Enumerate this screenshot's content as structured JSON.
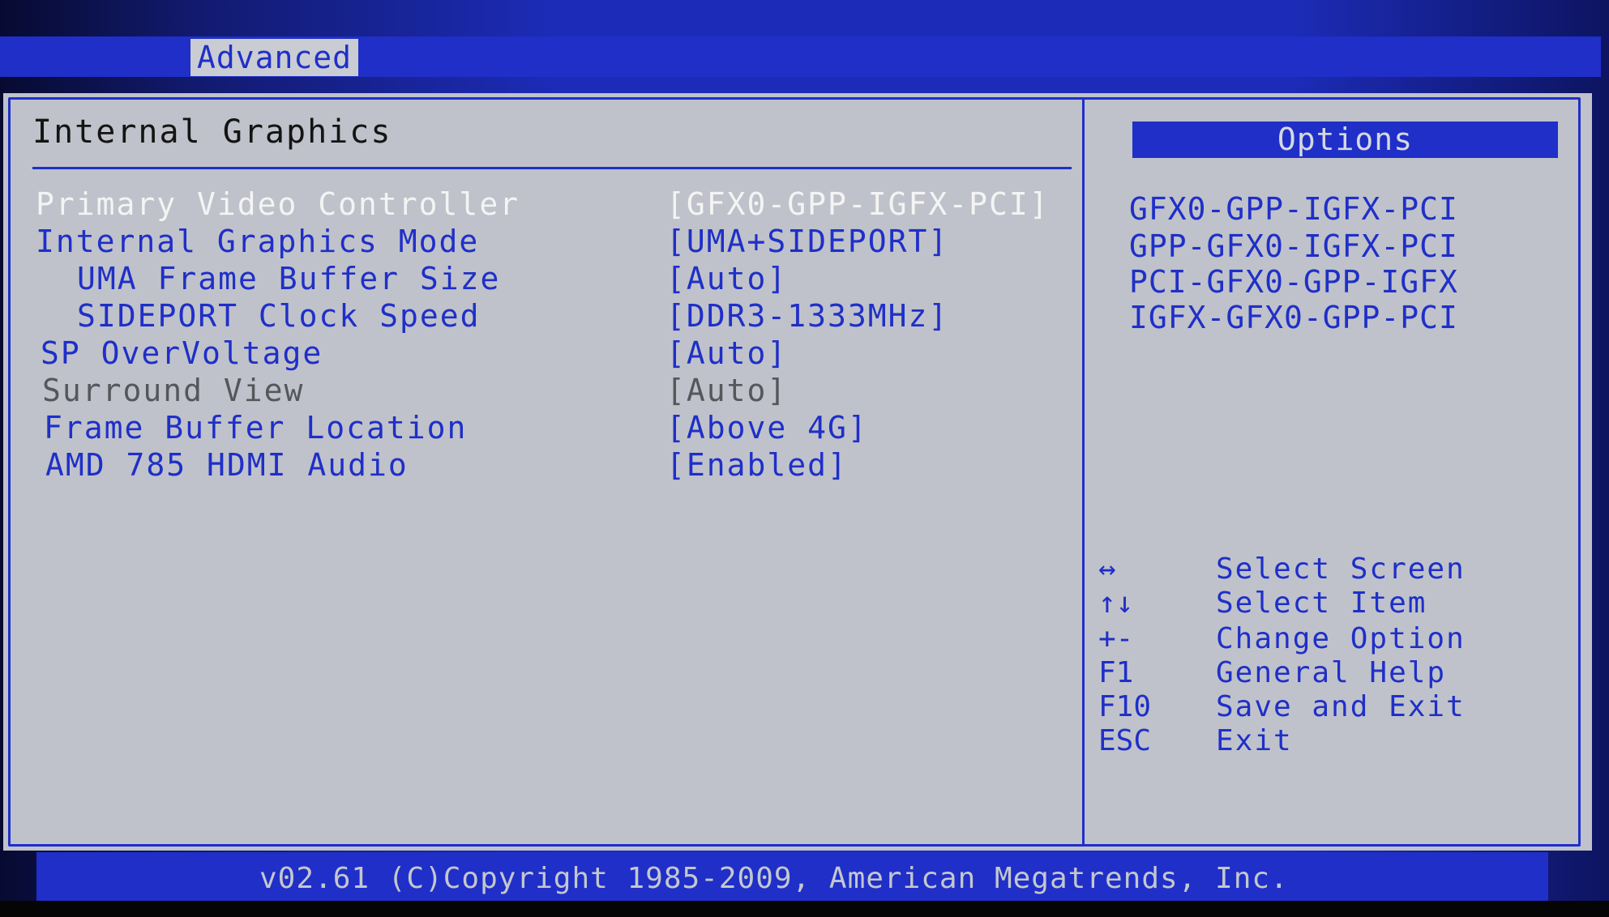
{
  "menu": {
    "active_tab": "Advanced"
  },
  "section": {
    "title": "Internal Graphics"
  },
  "settings": [
    {
      "label": "Primary Video Controller",
      "value": "[GFX0-GPP-IGFX-PCI]"
    },
    {
      "label": "Internal Graphics Mode",
      "value": "[UMA+SIDEPORT]"
    },
    {
      "label": "UMA Frame Buffer Size",
      "value": "[Auto]"
    },
    {
      "label": "SIDEPORT Clock Speed",
      "value": "[DDR3-1333MHz]"
    },
    {
      "label": "SP OverVoltage",
      "value": "[Auto]"
    },
    {
      "label": "Surround View",
      "value": "[Auto]"
    },
    {
      "label": "Frame Buffer Location",
      "value": "[Above 4G]"
    },
    {
      "label": "AMD 785 HDMI Audio",
      "value": "[Enabled]"
    }
  ],
  "options_panel": {
    "header": "Options",
    "items": [
      "GFX0-GPP-IGFX-PCI",
      "GPP-GFX0-IGFX-PCI",
      "PCI-GFX0-GPP-IGFX",
      "IGFX-GFX0-GPP-PCI"
    ]
  },
  "help": [
    {
      "key": "↔",
      "desc": "Select Screen"
    },
    {
      "key": "↑↓",
      "desc": "Select Item"
    },
    {
      "key": "+-",
      "desc": "Change Option"
    },
    {
      "key": "F1",
      "desc": "General Help"
    },
    {
      "key": "F10",
      "desc": "Save and Exit"
    },
    {
      "key": "ESC",
      "desc": "Exit"
    }
  ],
  "footer": {
    "copyright": "v02.61 (C)Copyright 1985-2009, American Megatrends, Inc."
  },
  "colors": {
    "bios_blue": "#1f2fc8",
    "panel_gray": "#bfc2ca",
    "selected_text": "#f4f4f4",
    "disabled_text": "#55575c"
  }
}
